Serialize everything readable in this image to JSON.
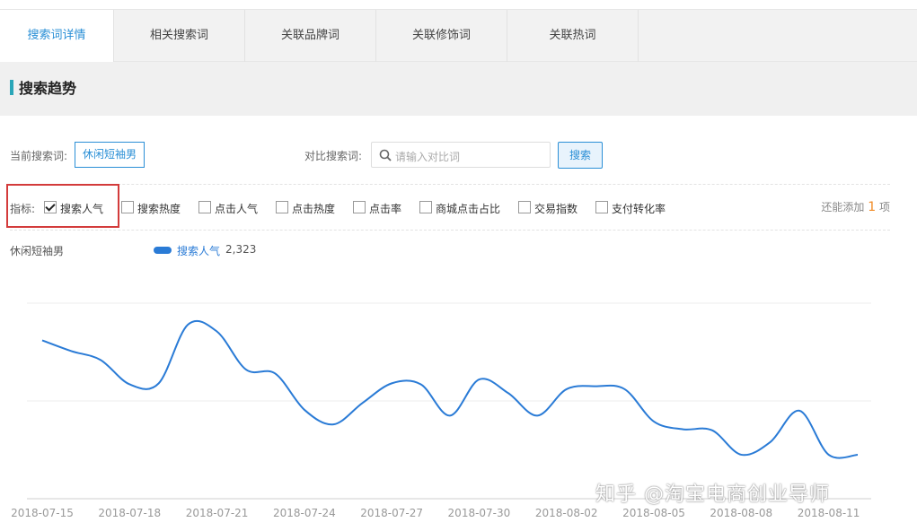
{
  "tabs": [
    {
      "label": "搜索词详情",
      "active": true
    },
    {
      "label": "相关搜索词",
      "active": false
    },
    {
      "label": "关联品牌词",
      "active": false
    },
    {
      "label": "关联修饰词",
      "active": false
    },
    {
      "label": "关联热词",
      "active": false
    }
  ],
  "section": {
    "title": "搜索趋势"
  },
  "search": {
    "current_label": "当前搜索词:",
    "current_value": "休闲短袖男",
    "compare_label": "对比搜索词:",
    "compare_placeholder": "请输入对比词",
    "search_button": "搜索"
  },
  "metrics": {
    "label": "指标:",
    "items": [
      {
        "label": "搜索人气",
        "checked": true
      },
      {
        "label": "搜索热度",
        "checked": false
      },
      {
        "label": "点击人气",
        "checked": false
      },
      {
        "label": "点击热度",
        "checked": false
      },
      {
        "label": "点击率",
        "checked": false
      },
      {
        "label": "商城点击占比",
        "checked": false
      },
      {
        "label": "交易指数",
        "checked": false
      },
      {
        "label": "支付转化率",
        "checked": false
      }
    ],
    "add_more_prefix": "还能添加",
    "add_more_count": "1",
    "add_more_suffix": "项"
  },
  "legend": {
    "series_title": "休闲短袖男",
    "name": "搜索人气",
    "value": "2,323",
    "color": "#2a7bd6"
  },
  "chart_data": {
    "type": "line",
    "x_tick_labels": [
      "2018-07-15",
      "2018-07-18",
      "2018-07-21",
      "2018-07-24",
      "2018-07-27",
      "2018-07-30",
      "2018-08-02",
      "2018-08-05",
      "2018-08-08",
      "2018-08-11"
    ],
    "x": [
      "2018-07-15",
      "2018-07-16",
      "2018-07-17",
      "2018-07-18",
      "2018-07-19",
      "2018-07-20",
      "2018-07-21",
      "2018-07-22",
      "2018-07-23",
      "2018-07-24",
      "2018-07-25",
      "2018-07-26",
      "2018-07-27",
      "2018-07-28",
      "2018-07-29",
      "2018-07-30",
      "2018-07-31",
      "2018-08-01",
      "2018-08-02",
      "2018-08-03",
      "2018-08-04",
      "2018-08-05",
      "2018-08-06",
      "2018-08-07",
      "2018-08-08",
      "2018-08-09",
      "2018-08-10",
      "2018-08-11",
      "2018-08-12"
    ],
    "series": [
      {
        "name": "搜索人气",
        "values": [
          1.62,
          1.51,
          1.42,
          1.17,
          1.18,
          1.78,
          1.71,
          1.32,
          1.28,
          0.91,
          0.76,
          0.98,
          1.18,
          1.17,
          0.85,
          1.22,
          1.08,
          0.85,
          1.12,
          1.15,
          1.12,
          0.79,
          0.71,
          0.7,
          0.45,
          0.58,
          0.9,
          0.45,
          0.45
        ]
      }
    ],
    "ylim": [
      0,
      2
    ],
    "grid": true,
    "legend": "top-left"
  },
  "watermark": "知乎 @淘宝电商创业导师"
}
